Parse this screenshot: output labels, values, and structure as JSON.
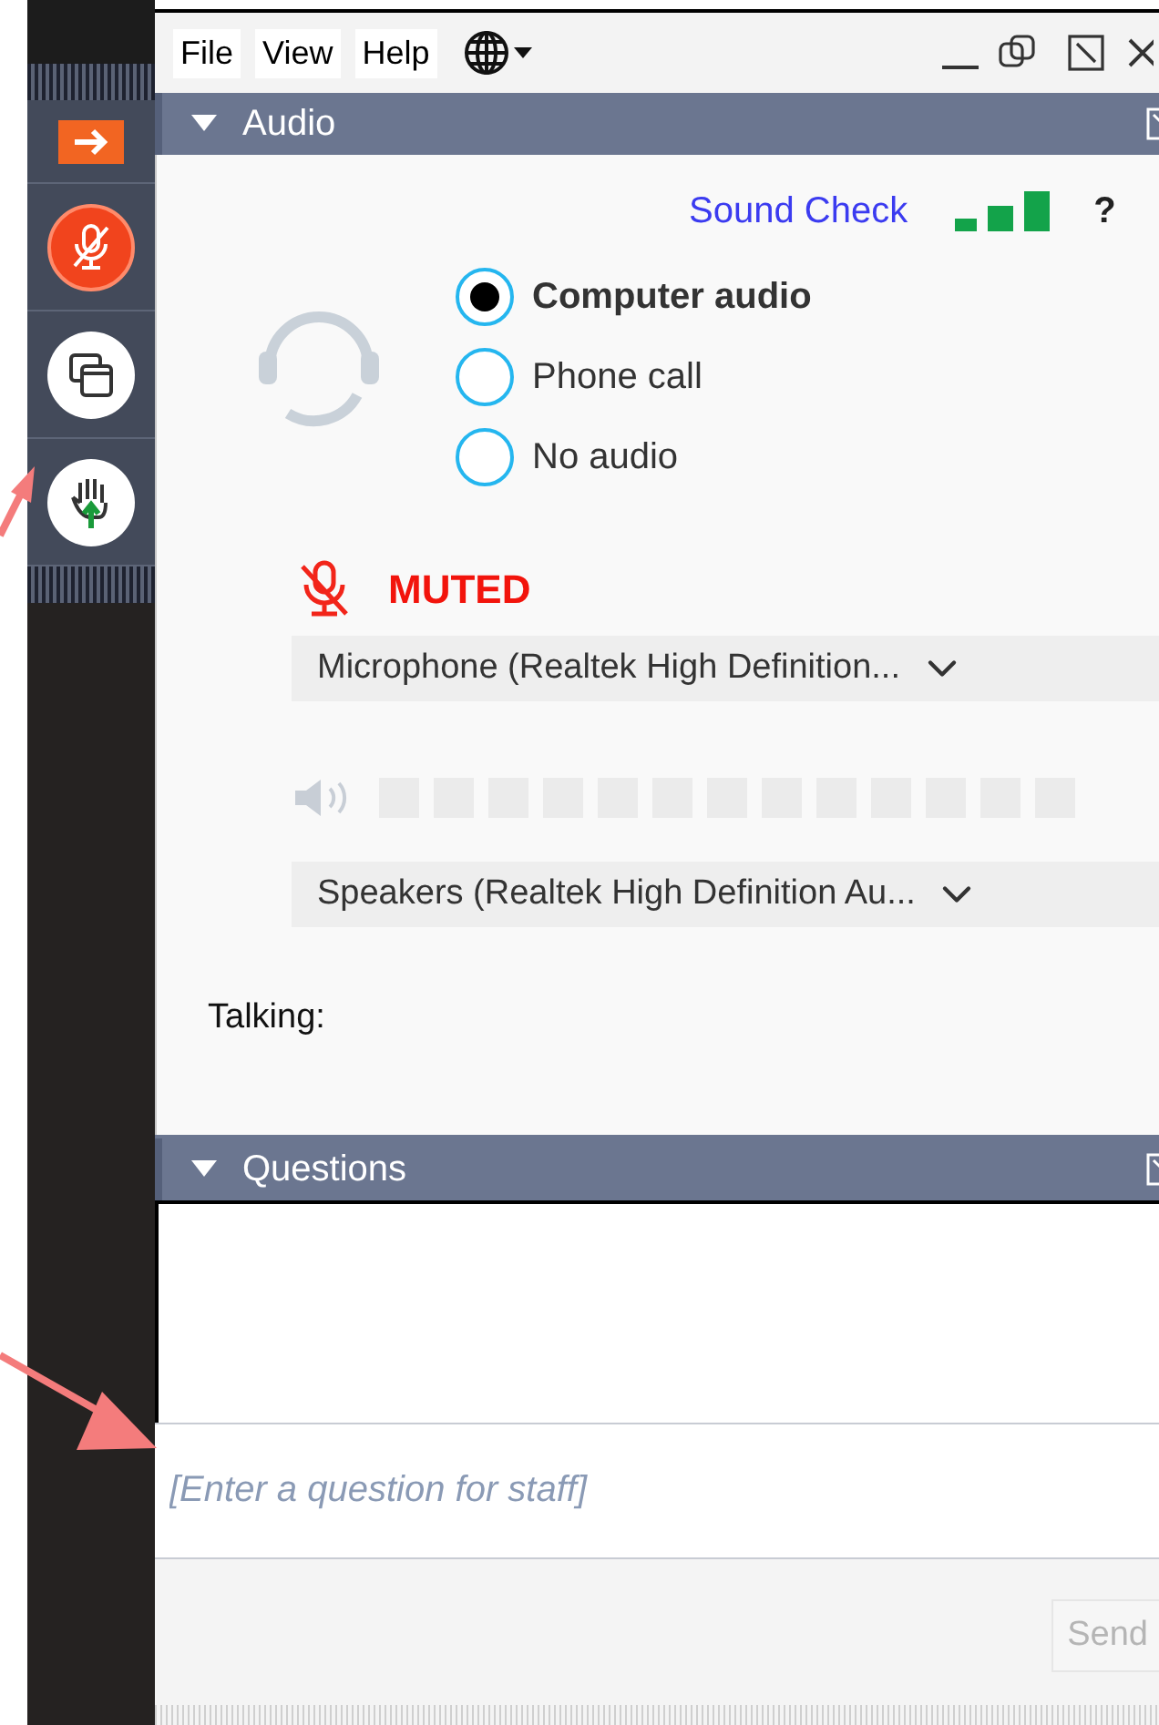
{
  "toolbar": {
    "buttons": [
      {
        "kind": "arrow"
      },
      {
        "kind": "mic"
      },
      {
        "kind": "screen"
      },
      {
        "kind": "hand"
      }
    ]
  },
  "menu": {
    "items": [
      "File",
      "View",
      "Help"
    ]
  },
  "audio_panel": {
    "title": "Audio",
    "expanded": true,
    "sound_check": "Sound Check",
    "help": "?",
    "modes": [
      {
        "label": "Computer audio",
        "selected": true
      },
      {
        "label": "Phone call",
        "selected": false
      },
      {
        "label": "No audio",
        "selected": false
      }
    ],
    "muted": true,
    "muted_label": "MUTED",
    "microphone": "Microphone (Realtek High Definition...",
    "speaker_meter": {
      "level": 0
    },
    "speakers": "Speakers (Realtek High Definition Au...",
    "talking_label": "Talking:"
  },
  "questions_panel": {
    "title": "Questions",
    "expanded": true,
    "input": {
      "placeholder": "[Enter a question for staff]"
    },
    "send_button": {
      "label": "Send",
      "disabled": true
    }
  }
}
